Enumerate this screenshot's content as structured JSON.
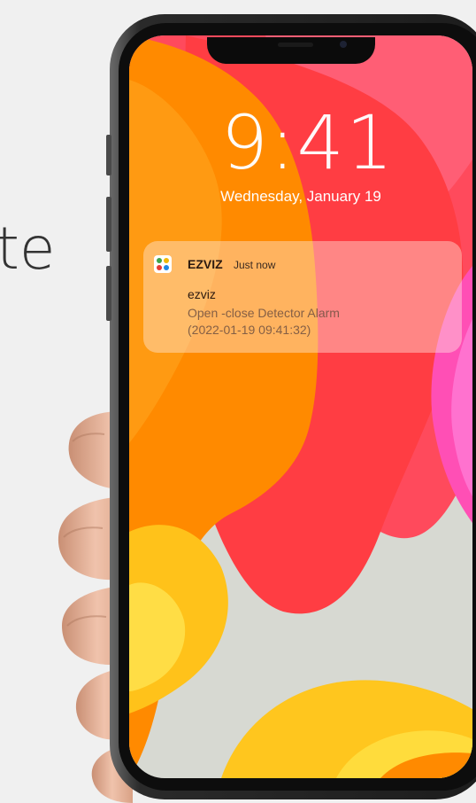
{
  "side_text": "te",
  "lock_screen": {
    "time": "9:41",
    "date": "Wednesday, January 19"
  },
  "notification": {
    "app_name": "EZVIZ",
    "time_label": "Just now",
    "title": "ezviz",
    "body_line1": "Open -close Detector Alarm",
    "body_line2": "(2022-01-19  09:41:32)"
  },
  "colors": {
    "wallpaper_base": "#d7d9d2",
    "accent_orange": "#ff8a00",
    "accent_red": "#ff3d4a",
    "accent_pink": "#ff3d8c",
    "phone_frame": "#2a2a2a"
  }
}
